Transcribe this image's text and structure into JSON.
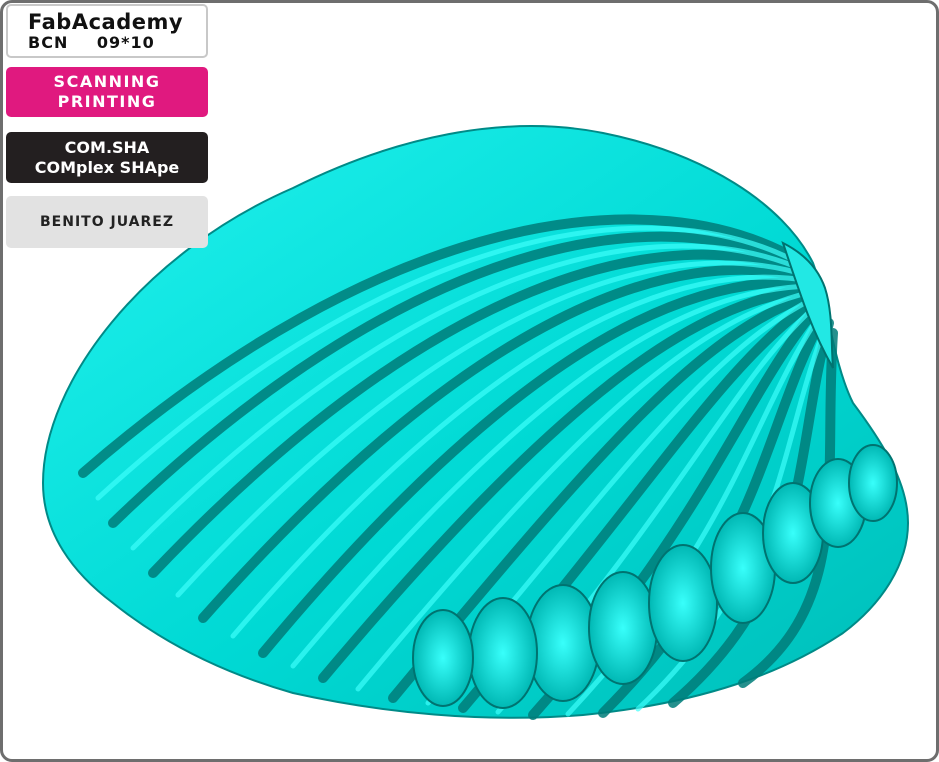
{
  "header": {
    "title": "FabAcademy",
    "location": "BCN",
    "date": "09*10"
  },
  "topic": {
    "line1": "SCANNING",
    "line2": "PRINTING"
  },
  "project": {
    "line1": "COM.SHA",
    "line2": "COMplex SHApe"
  },
  "author": {
    "name": "BENITO JUAREZ"
  },
  "colors": {
    "accent_magenta": "#e0197f",
    "dark_panel": "#231f20",
    "light_panel": "#e2e2e2",
    "model_cyan": "#00e5e0",
    "model_shadow": "#006e6e"
  },
  "viewport": {
    "model": "scallop-shell-3d-scan"
  }
}
